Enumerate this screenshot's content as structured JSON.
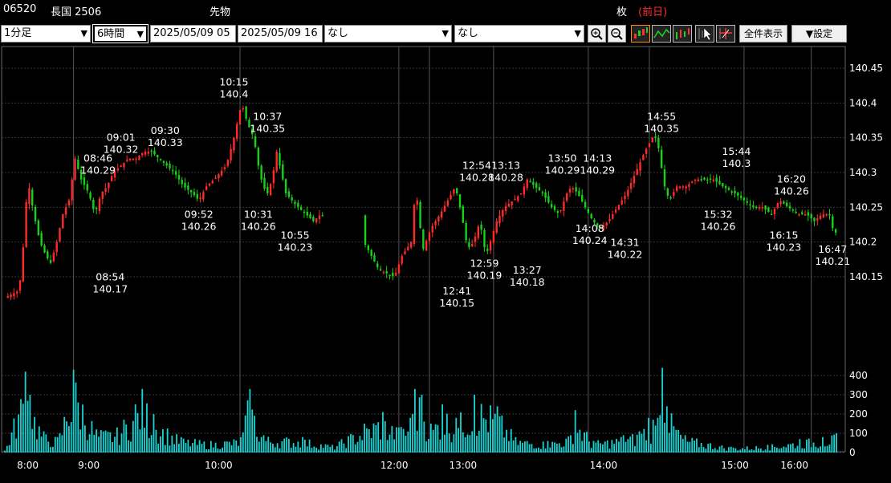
{
  "header": {
    "code": "06520",
    "name": "長国 2506",
    "kind": "先物",
    "unit": "枚",
    "prev_day": "(前日)"
  },
  "toolbar": {
    "interval": "1分足",
    "span": "6時間",
    "from": "2025/05/09 05",
    "to": "2025/05/09 16",
    "indicator1": "なし",
    "indicator2": "なし",
    "zoom_in_icon": "zoom-in-icon",
    "zoom_out_icon": "zoom-out-icon",
    "show_all": "全件表示",
    "settings": "▼設定"
  },
  "colors": {
    "up": "#ff2a2a",
    "down": "#17d317",
    "volume": "#19d4d4",
    "grid": "#3a3a3a"
  },
  "chart_data": {
    "type": "candlestick",
    "price_axis": {
      "min": 140.1,
      "max": 140.47,
      "ticks": [
        "140.45",
        "140.4",
        "140.35",
        "140.3",
        "140.25",
        "140.2",
        "140.15"
      ]
    },
    "volume_axis": {
      "min": 0,
      "max": 450,
      "ticks": [
        "400",
        "300",
        "200",
        "100",
        "0"
      ]
    },
    "time_ticks": [
      "8:00",
      "9:00",
      "10:00",
      "12:00",
      "13:00",
      "14:00",
      "15:00",
      "16:00"
    ],
    "time_range_minutes": [
      465,
      1010
    ],
    "session_lines_minutes": [
      463,
      510,
      619,
      723,
      743,
      785,
      847,
      887,
      949,
      993
    ],
    "labels": [
      {
        "time": "08:46",
        "price": "140.29",
        "pos": "above"
      },
      {
        "time": "08:54",
        "price": "140.17",
        "pos": "below"
      },
      {
        "time": "09:01",
        "price": "140.32",
        "pos": "above"
      },
      {
        "time": "09:30",
        "price": "140.33",
        "pos": "above"
      },
      {
        "time": "09:52",
        "price": "140.26",
        "pos": "below"
      },
      {
        "time": "10:15",
        "price": "140.4",
        "pos": "above"
      },
      {
        "time": "10:31",
        "price": "140.26",
        "pos": "below"
      },
      {
        "time": "10:37",
        "price": "140.35",
        "pos": "above"
      },
      {
        "time": "10:55",
        "price": "140.23",
        "pos": "below"
      },
      {
        "time": "12:41",
        "price": "140.15",
        "pos": "below"
      },
      {
        "time": "12:54",
        "price": "140.28",
        "pos": "above"
      },
      {
        "time": "12:59",
        "price": "140.19",
        "pos": "below"
      },
      {
        "time": "13:13",
        "price": "140.28",
        "pos": "above"
      },
      {
        "time": "13:27",
        "price": "140.18",
        "pos": "below"
      },
      {
        "time": "13:50",
        "price": "140.29",
        "pos": "above"
      },
      {
        "time": "14:08",
        "price": "140.24",
        "pos": "below"
      },
      {
        "time": "14:13",
        "price": "140.29",
        "pos": "above"
      },
      {
        "time": "14:31",
        "price": "140.22",
        "pos": "below"
      },
      {
        "time": "14:55",
        "price": "140.35",
        "pos": "above"
      },
      {
        "time": "15:32",
        "price": "140.26",
        "pos": "below"
      },
      {
        "time": "15:44",
        "price": "140.3",
        "pos": "above"
      },
      {
        "time": "16:15",
        "price": "140.23",
        "pos": "below"
      },
      {
        "time": "16:20",
        "price": "140.26",
        "pos": "above"
      },
      {
        "time": "16:47",
        "price": "140.21",
        "pos": "below"
      }
    ],
    "price_path": [
      [
        465,
        140.12
      ],
      [
        474,
        140.13
      ],
      [
        476,
        140.16
      ],
      [
        480,
        140.29
      ],
      [
        484,
        140.24
      ],
      [
        488,
        140.2
      ],
      [
        492,
        140.18
      ],
      [
        495,
        140.17
      ],
      [
        499,
        140.2
      ],
      [
        503,
        140.24
      ],
      [
        507,
        140.26
      ],
      [
        511,
        140.32
      ],
      [
        515,
        140.29
      ],
      [
        520,
        140.27
      ],
      [
        524,
        140.24
      ],
      [
        528,
        140.27
      ],
      [
        532,
        140.28
      ],
      [
        536,
        140.3
      ],
      [
        541,
        140.31
      ],
      [
        546,
        140.32
      ],
      [
        551,
        140.32
      ],
      [
        556,
        140.33
      ],
      [
        561,
        140.33
      ],
      [
        566,
        140.32
      ],
      [
        571,
        140.31
      ],
      [
        576,
        140.3
      ],
      [
        582,
        140.28
      ],
      [
        588,
        140.27
      ],
      [
        592,
        140.26
      ],
      [
        597,
        140.28
      ],
      [
        602,
        140.29
      ],
      [
        606,
        140.3
      ],
      [
        610,
        140.31
      ],
      [
        615,
        140.35
      ],
      [
        620,
        140.4
      ],
      [
        624,
        140.37
      ],
      [
        628,
        140.35
      ],
      [
        631,
        140.31
      ],
      [
        634,
        140.28
      ],
      [
        637,
        140.27
      ],
      [
        640,
        140.29
      ],
      [
        643,
        140.33
      ],
      [
        646,
        140.3
      ],
      [
        649,
        140.27
      ],
      [
        653,
        140.26
      ],
      [
        657,
        140.25
      ],
      [
        662,
        140.24
      ],
      [
        667,
        140.23
      ],
      [
        672,
        140.24
      ],
      [
        700,
        140.2
      ],
      [
        710,
        140.16
      ],
      [
        720,
        140.15
      ],
      [
        725,
        140.18
      ],
      [
        731,
        140.2
      ],
      [
        734,
        140.28
      ],
      [
        737,
        140.22
      ],
      [
        739,
        140.19
      ],
      [
        744,
        140.22
      ],
      [
        750,
        140.24
      ],
      [
        755,
        140.26
      ],
      [
        760,
        140.28
      ],
      [
        764,
        140.24
      ],
      [
        768,
        140.19
      ],
      [
        772,
        140.2
      ],
      [
        776,
        140.23
      ],
      [
        780,
        140.18
      ],
      [
        787,
        140.23
      ],
      [
        792,
        140.25
      ],
      [
        798,
        140.26
      ],
      [
        803,
        140.27
      ],
      [
        807,
        140.29
      ],
      [
        812,
        140.28
      ],
      [
        817,
        140.27
      ],
      [
        823,
        140.25
      ],
      [
        828,
        140.24
      ],
      [
        833,
        140.27
      ],
      [
        836,
        140.28
      ],
      [
        840,
        140.27
      ],
      [
        845,
        140.25
      ],
      [
        850,
        140.23
      ],
      [
        855,
        140.22
      ],
      [
        860,
        140.23
      ],
      [
        866,
        140.25
      ],
      [
        872,
        140.27
      ],
      [
        878,
        140.3
      ],
      [
        884,
        140.33
      ],
      [
        889,
        140.35
      ],
      [
        892,
        140.35
      ],
      [
        894,
        140.32
      ],
      [
        897,
        140.28
      ],
      [
        900,
        140.26
      ],
      [
        905,
        140.28
      ],
      [
        911,
        140.28
      ],
      [
        917,
        140.29
      ],
      [
        923,
        140.29
      ],
      [
        929,
        140.29
      ],
      [
        935,
        140.28
      ],
      [
        943,
        140.27
      ],
      [
        949,
        140.26
      ],
      [
        955,
        140.25
      ],
      [
        961,
        140.25
      ],
      [
        967,
        140.24
      ],
      [
        972,
        140.26
      ],
      [
        978,
        140.25
      ],
      [
        984,
        140.24
      ],
      [
        990,
        140.24
      ],
      [
        995,
        140.23
      ],
      [
        1000,
        140.24
      ],
      [
        1005,
        140.24
      ],
      [
        1007,
        140.22
      ],
      [
        1010,
        140.21
      ]
    ],
    "volume_profile": [
      [
        465,
        10
      ],
      [
        479,
        420
      ],
      [
        482,
        300
      ],
      [
        490,
        110
      ],
      [
        500,
        80
      ],
      [
        510,
        430
      ],
      [
        525,
        120
      ],
      [
        538,
        130
      ],
      [
        550,
        250
      ],
      [
        555,
        330
      ],
      [
        562,
        200
      ],
      [
        580,
        80
      ],
      [
        600,
        60
      ],
      [
        620,
        80
      ],
      [
        625,
        330
      ],
      [
        634,
        90
      ],
      [
        660,
        80
      ],
      [
        680,
        40
      ],
      [
        700,
        150
      ],
      [
        712,
        210
      ],
      [
        723,
        130
      ],
      [
        731,
        180
      ],
      [
        734,
        330
      ],
      [
        738,
        300
      ],
      [
        744,
        150
      ],
      [
        752,
        250
      ],
      [
        760,
        180
      ],
      [
        773,
        300
      ],
      [
        787,
        240
      ],
      [
        800,
        80
      ],
      [
        820,
        60
      ],
      [
        835,
        90
      ],
      [
        838,
        220
      ],
      [
        850,
        60
      ],
      [
        870,
        90
      ],
      [
        880,
        110
      ],
      [
        886,
        180
      ],
      [
        889,
        170
      ],
      [
        893,
        180
      ],
      [
        896,
        440
      ],
      [
        899,
        240
      ],
      [
        910,
        90
      ],
      [
        940,
        30
      ],
      [
        965,
        40
      ],
      [
        985,
        70
      ],
      [
        1000,
        80
      ],
      [
        1010,
        100
      ]
    ]
  }
}
